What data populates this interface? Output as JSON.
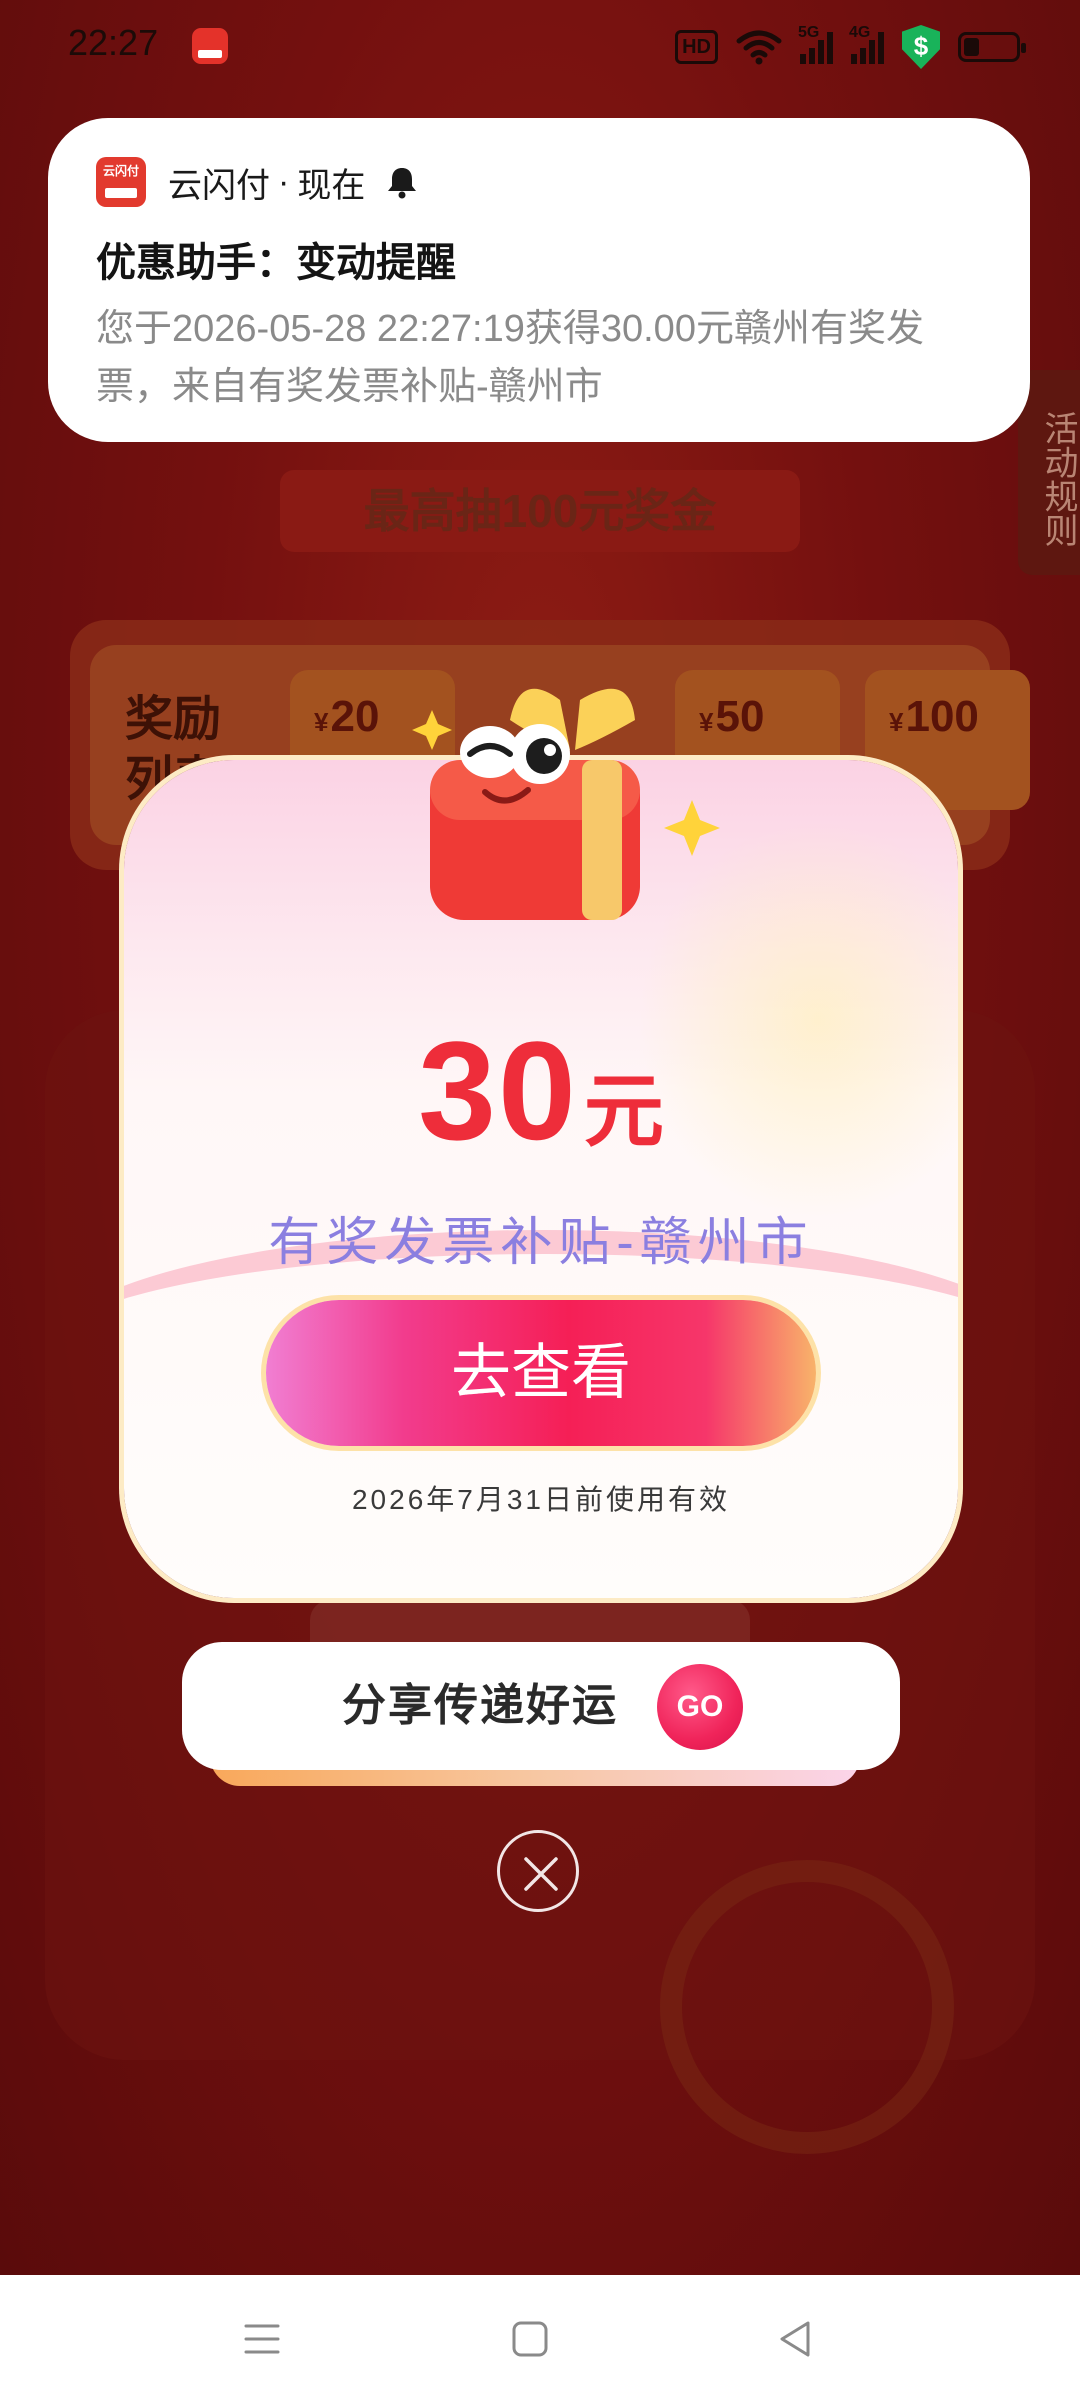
{
  "status_bar": {
    "time": "22:27",
    "hd_label": "HD",
    "signal_1_label": "5G",
    "signal_2_label": "4G",
    "shield_symbol": "$",
    "battery_level": 0.3
  },
  "notification": {
    "app_name": "云闪付",
    "app_icon_text": "云闪付",
    "separator": "·",
    "time": "现在",
    "title": "优惠助手：变动提醒",
    "body": "您于2026-05-28 22:27:19获得30.00元赣州有奖发票，来自有奖发票补贴-赣州市"
  },
  "background": {
    "ribbon_text": "最高抽100元奖金",
    "side_rules": "活动规则",
    "reward_list_title": "奖励列表",
    "reward_chips": [
      {
        "currency": "¥",
        "amount": "20"
      },
      {
        "currency": "¥",
        "amount": "50"
      },
      {
        "currency": "¥",
        "amount": "100"
      }
    ]
  },
  "dialog": {
    "amount": "30",
    "unit": "元",
    "subsidy_name": "有奖发票补贴-赣州市",
    "view_button": "去查看",
    "validity": "2026年7月31日前使用有效"
  },
  "share": {
    "label": "分享传递好运",
    "go_label": "GO"
  },
  "colors": {
    "accent_red": "#ee2d3a",
    "subsidy_purple": "#8b7fe0",
    "background_red": "#74100f"
  }
}
